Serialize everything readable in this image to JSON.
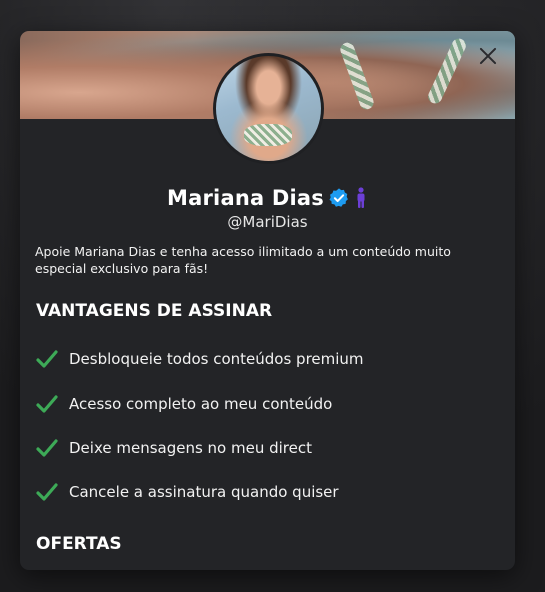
{
  "modal": {
    "profile": {
      "name": "Mariana Dias",
      "handle": "@MariDias",
      "verified": true,
      "verified_color": "#1d9bf0",
      "badge_color": "#6c3fd6"
    },
    "bio": "Apoie Mariana Dias e tenha acesso ilimitado a um conteúdo muito especial exclusivo para fãs!",
    "benefits_title": "VANTAGENS DE ASSINAR",
    "benefits": [
      {
        "icon": "check-icon",
        "label": "Desbloqueie todos conteúdos premium"
      },
      {
        "icon": "check-icon",
        "label": "Acesso completo ao meu conteúdo"
      },
      {
        "icon": "check-icon",
        "label": "Deixe mensagens no meu direct"
      },
      {
        "icon": "check-icon",
        "label": "Cancele a assinatura quando quiser"
      }
    ],
    "offers_title": "OFERTAS",
    "check_color": "#3daa57"
  }
}
